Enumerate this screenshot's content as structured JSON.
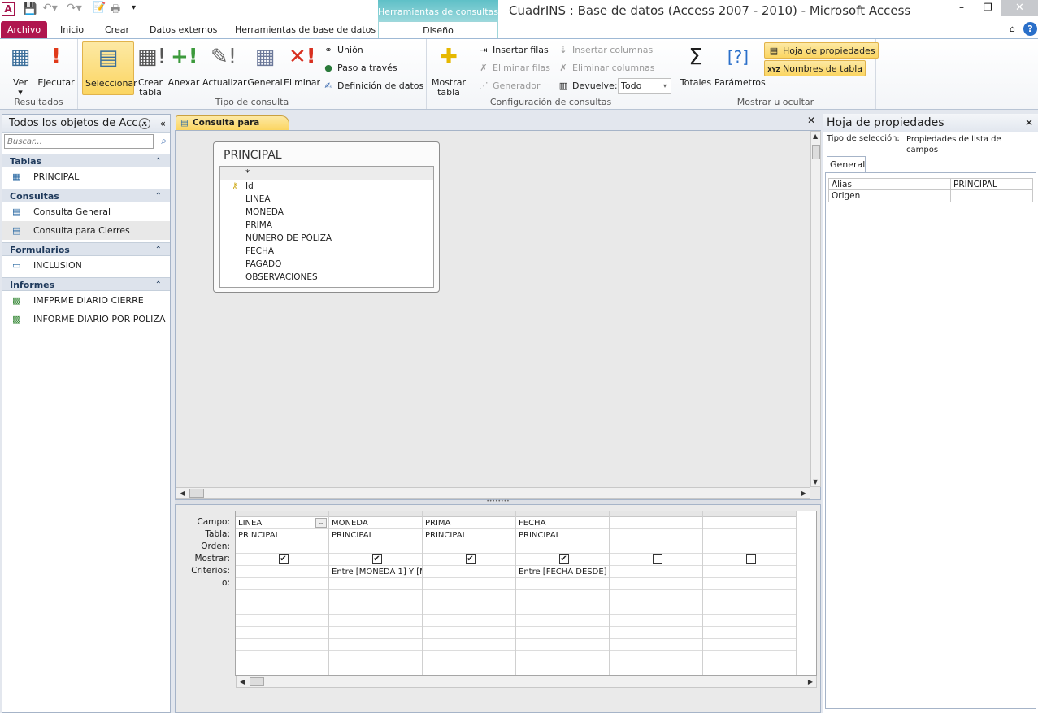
{
  "app": {
    "title": "CuadrINS : Base de datos (Access 2007 - 2010)  -  Microsoft Access",
    "context_tab": "Herramientas de consultas",
    "accent": "#a4134b"
  },
  "tabs": [
    "Archivo",
    "Inicio",
    "Crear",
    "Datos externos",
    "Herramientas de base de datos",
    "Diseño"
  ],
  "ribbon": {
    "resultados": {
      "label": "Resultados",
      "ver": "Ver",
      "ejecutar": "Ejecutar"
    },
    "tipo": {
      "label": "Tipo de consulta",
      "seleccionar": "Seleccionar",
      "crear_tabla_1": "Crear",
      "crear_tabla_2": "tabla",
      "anexar": "Anexar",
      "actualizar": "Actualizar",
      "general": "General",
      "eliminar": "Eliminar",
      "union": "Unión",
      "paso": "Paso a través",
      "definicion": "Definición de datos"
    },
    "config": {
      "label": "Configuración de consultas",
      "mostrar_1": "Mostrar",
      "mostrar_2": "tabla",
      "insertar_filas": "Insertar filas",
      "eliminar_filas": "Eliminar filas",
      "generador": "Generador",
      "insertar_columnas": "Insertar columnas",
      "eliminar_columnas": "Eliminar columnas",
      "devuelve": "Devuelve:",
      "devuelve_value": "Todo"
    },
    "mostrar": {
      "label": "Mostrar u ocultar",
      "totales": "Totales",
      "parametros": "Parámetros",
      "hoja": "Hoja de propiedades",
      "nombres": "Nombres de tabla"
    }
  },
  "nav": {
    "header": "Todos los objetos de Acc...",
    "search_placeholder": "Buscar...",
    "groups": [
      {
        "label": "Tablas",
        "items": [
          "PRINCIPAL"
        ]
      },
      {
        "label": "Consultas",
        "items": [
          "Consulta General",
          "Consulta para Cierres"
        ]
      },
      {
        "label": "Formularios",
        "items": [
          "INCLUSION"
        ]
      },
      {
        "label": "Informes",
        "items": [
          "IMFPRME DIARIO CIERRE",
          "INFORME DIARIO POR POLIZA"
        ]
      }
    ]
  },
  "document": {
    "tab": "Consulta para Cierres",
    "table": {
      "name": "PRINCIPAL",
      "fields": [
        "*",
        "Id",
        "LINEA",
        "MONEDA",
        "PRIMA",
        "NÚMERO DE PÓLIZA",
        "FECHA",
        "PAGADO",
        "OBSERVACIONES"
      ]
    },
    "grid": {
      "row_labels": [
        "Campo:",
        "Tabla:",
        "Orden:",
        "Mostrar:",
        "Criterios:",
        "o:"
      ],
      "columns": [
        {
          "campo": "LINEA",
          "tabla": "PRINCIPAL",
          "mostrar": true,
          "criterios": ""
        },
        {
          "campo": "MONEDA",
          "tabla": "PRINCIPAL",
          "mostrar": true,
          "criterios": "Entre [MONEDA 1] Y [M"
        },
        {
          "campo": "PRIMA",
          "tabla": "PRINCIPAL",
          "mostrar": true,
          "criterios": ""
        },
        {
          "campo": "FECHA",
          "tabla": "PRINCIPAL",
          "mostrar": true,
          "criterios": "Entre [FECHA DESDE]"
        },
        {
          "campo": "",
          "tabla": "",
          "mostrar": false,
          "criterios": ""
        },
        {
          "campo": "",
          "tabla": "",
          "mostrar": false,
          "criterios": ""
        }
      ]
    }
  },
  "props": {
    "title": "Hoja de propiedades",
    "sel_label": "Tipo de selección:",
    "sel_value": "Propiedades de lista de campos",
    "tab": "General",
    "rows": [
      {
        "name": "Alias",
        "value": "PRINCIPAL"
      },
      {
        "name": "Origen",
        "value": ""
      }
    ]
  }
}
